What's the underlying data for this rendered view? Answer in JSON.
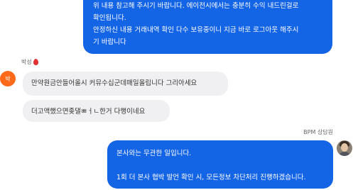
{
  "top_agent_message": {
    "lines": [
      "위 내용 참고해 주시기 바랍니다. 에이전시에서는 충분히 수익 내드린걸로",
      "확인됩니다.",
      "안정하신 내용 거래내역 확인 다수 보유중이니 지금 바로 로그아웃 해주시",
      "기 바랍니다"
    ]
  },
  "user": {
    "name": "박성",
    "avatar_text": "박",
    "avatar_color": "#ff6a1a",
    "name_icon": "red-drop-icon"
  },
  "user_messages": [
    "만약원금안들어올시 커뮤수십군데매일올립니다 그리아세요",
    "더고액했으면좆댈ㅃㅓㄴ한거 다행이네요"
  ],
  "agent": {
    "name": "BPM 상담원",
    "bubble_color": "#1464e6"
  },
  "bottom_agent_message": {
    "lines": [
      "본사와는 무관한 일입니다.",
      "",
      "1회 더 본사 협박 발언 확인 시, 모든정보 차단처리 진행하겠습니다."
    ]
  }
}
